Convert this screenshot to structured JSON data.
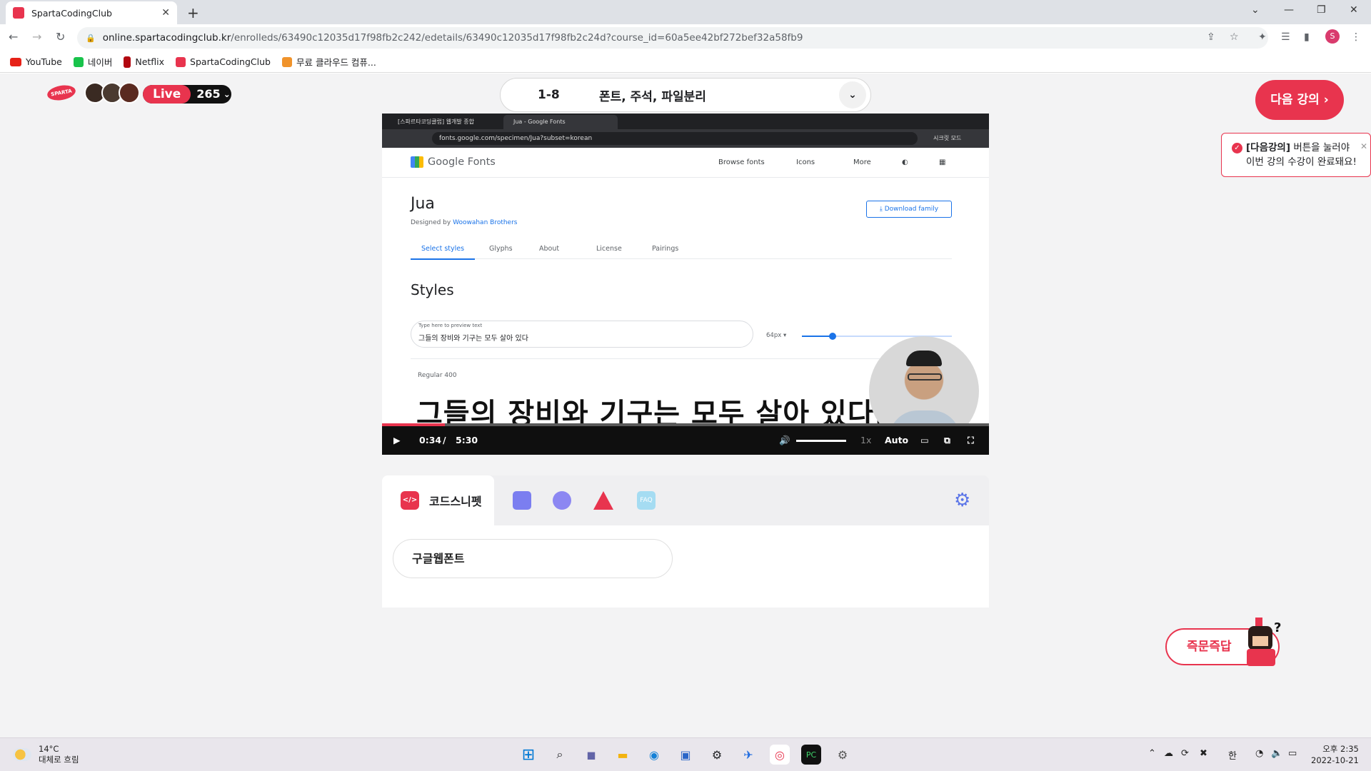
{
  "browser": {
    "tab_title": "SpartaCodingClub",
    "url_host": "online.spartacodingclub.kr",
    "url_path": "/enrolleds/63490c12035d17f98fb2c242/edetails/63490c12035d17f98fb2c24d?course_id=60a5ee42bf272bef32a58fb9",
    "profile_initial": "S",
    "bookmarks": [
      "YouTube",
      "네이버",
      "Netflix",
      "SpartaCodingClub",
      "무료 클라우드 컴퓨..."
    ]
  },
  "header": {
    "logo_text": "SPARTA",
    "live_label": "Live",
    "live_count": "265",
    "lesson_number": "1-8",
    "lesson_title": "폰트, 주석, 파일분리",
    "next_button": "다음 강의",
    "tooltip_bold": "[다음강의]",
    "tooltip_line1": " 버튼을 눌러야",
    "tooltip_line2": "이번 강의 수강이 완료돼요!"
  },
  "video": {
    "inner_tab1": "[스파르타코딩클럽] 웹개발 종합",
    "inner_tab2": "Jua - Google Fonts",
    "inner_url": "fonts.google.com/specimen/Jua?subset=korean",
    "incognito": "시크릿 모드",
    "gf_logo": "Google Fonts",
    "gf_nav": [
      "Browse fonts",
      "Icons",
      "More"
    ],
    "font_name": "Jua",
    "designed_by": "Designed by ",
    "designer": "Woowahan Brothers",
    "download": "Download family",
    "tabs": [
      "Select styles",
      "Glyphs",
      "About",
      "License",
      "Pairings"
    ],
    "styles_heading": "Styles",
    "preview_label": "Type here to preview text",
    "preview_text": "그들의 장비와 기구는 모두 살아 있다",
    "size": "64px",
    "regular": "Regular 400",
    "sample": "그들의 장비와 기구는 모두 살아 있다.",
    "time_current": "0:34",
    "time_sep": "/",
    "time_total": "5:30",
    "speed": "1x",
    "quality": "Auto",
    "progress": 0.103
  },
  "panel": {
    "active_tab": "코드스니펫",
    "faq": "FAQ",
    "snippet": "구글웹폰트"
  },
  "qa_button": "즉문즉답",
  "taskbar": {
    "temp": "14°C",
    "weather": "대체로 흐림",
    "ime": "한",
    "time": "오후 2:35",
    "date": "2022-10-21"
  }
}
